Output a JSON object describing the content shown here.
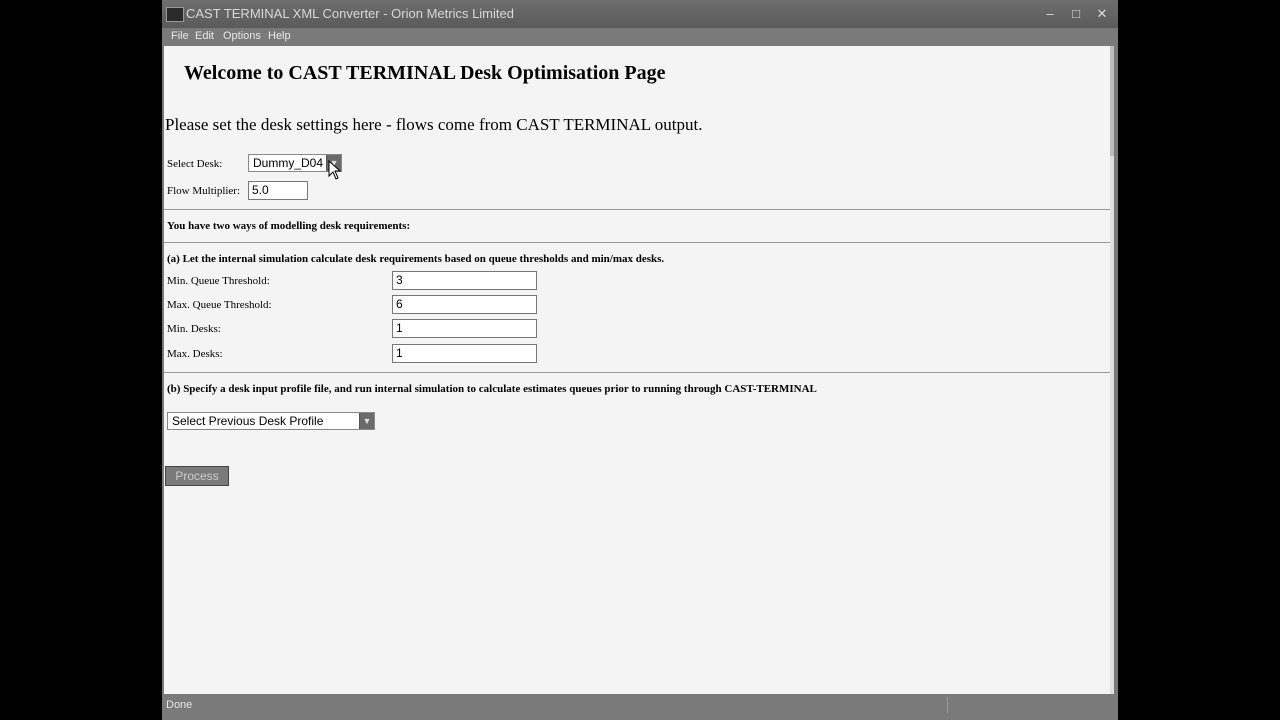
{
  "window": {
    "title": "CAST TERMINAL XML Converter - Orion Metrics Limited",
    "controls": {
      "minimize": "–",
      "maximize": "□",
      "close": "✕"
    },
    "menu": [
      "File",
      "Edit",
      "Options",
      "Help"
    ]
  },
  "page": {
    "heading": "Welcome to CAST TERMINAL Desk Optimisation Page",
    "intro": "Please set the desk settings here - flows come from CAST TERMINAL output.",
    "select_desk": {
      "label": "Select Desk:",
      "value": "Dummy_D04"
    },
    "flow_multiplier": {
      "label": "Flow Multiplier:",
      "value": "5.0"
    },
    "two_ways": "You have two ways of modelling desk requirements:",
    "option_a": {
      "title": "(a) Let the internal simulation calculate desk requirements based on queue thresholds and min/max desks.",
      "fields": [
        {
          "label": "Min. Queue Threshold:",
          "value": "3"
        },
        {
          "label": "Max. Queue Threshold:",
          "value": "6"
        },
        {
          "label": "Min. Desks:",
          "value": "1"
        },
        {
          "label": "Max. Desks:",
          "value": "1"
        }
      ]
    },
    "option_b": {
      "title": "(b) Specify a desk input profile file, and run internal simulation to calculate estimates queues prior to running through CAST-TERMINAL",
      "profile_select": "Select Previous Desk Profile"
    },
    "process_button": "Process"
  },
  "status": {
    "text": "Done"
  },
  "icons": {
    "dropdown_arrow": "▼",
    "cursor": "arrow-cursor-icon",
    "app": "app-icon"
  }
}
